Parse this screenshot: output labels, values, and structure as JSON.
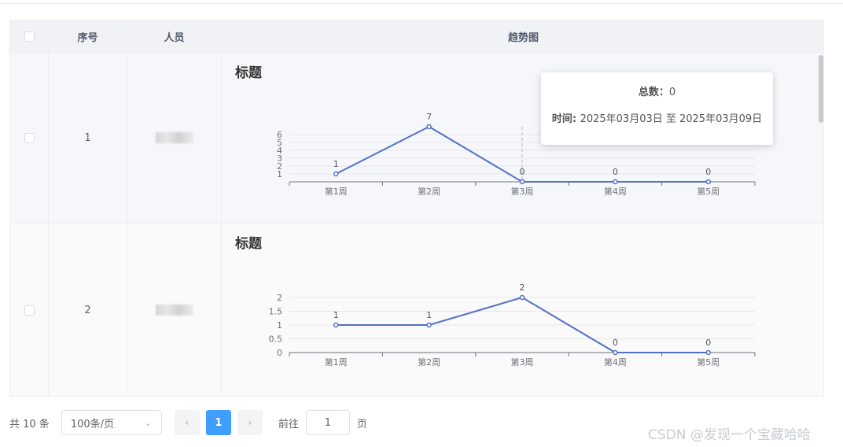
{
  "table": {
    "headers": {
      "index": "序号",
      "person": "人员",
      "trend": "趋势图"
    },
    "rows": [
      {
        "index": "1",
        "chart": {
          "title": "标题",
          "categories": [
            "第1周",
            "第2周",
            "第3周",
            "第4周",
            "第5周"
          ],
          "values": [
            1,
            7,
            0,
            0,
            0
          ],
          "yticks": [
            "1",
            "2",
            "3",
            "4",
            "5",
            "6"
          ]
        }
      },
      {
        "index": "2",
        "chart": {
          "title": "标题",
          "categories": [
            "第1周",
            "第2周",
            "第3周",
            "第4周",
            "第5周"
          ],
          "values": [
            1,
            1,
            2,
            0,
            0
          ],
          "yticks": [
            "0",
            "0.5",
            "1",
            "1.5",
            "2"
          ]
        }
      }
    ]
  },
  "tooltip": {
    "total_label": "总数：",
    "total_value": "0",
    "time_label": "时间: ",
    "time_value": "2025年03月03日 至 2025年03月09日"
  },
  "pagination": {
    "total_text": "共 10 条",
    "page_size": "100条/页",
    "prev_icon": "chevron-left-icon",
    "next_icon": "chevron-right-icon",
    "current_page": "1",
    "goto_label": "前往",
    "goto_value": "1",
    "page_suffix": "页"
  },
  "watermark": "CSDN @发现一个宝藏哈哈",
  "colors": {
    "line": "#5470c6",
    "accent": "#409eff"
  },
  "chart_data": [
    {
      "type": "line",
      "title": "标题",
      "categories": [
        "第1周",
        "第2周",
        "第3周",
        "第4周",
        "第5周"
      ],
      "series": [
        {
          "values": [
            1,
            7,
            0,
            0,
            0
          ]
        }
      ],
      "ylim": [
        0,
        7
      ]
    },
    {
      "type": "line",
      "title": "标题",
      "categories": [
        "第1周",
        "第2周",
        "第3周",
        "第4周",
        "第5周"
      ],
      "series": [
        {
          "values": [
            1,
            1,
            2,
            0,
            0
          ]
        }
      ],
      "ylim": [
        0,
        2
      ]
    }
  ]
}
